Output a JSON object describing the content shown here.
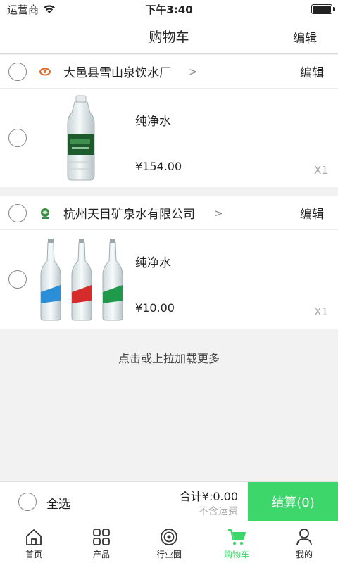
{
  "status_bar": {
    "carrier": "运营商",
    "time": "下午3:40"
  },
  "nav": {
    "title": "购物车",
    "edit_label": "编辑"
  },
  "stores": [
    {
      "name": "大邑县雪山泉饮水厂",
      "edit_label": "编辑",
      "items": [
        {
          "name": "纯净水",
          "price": "¥154.00",
          "quantity": "X1"
        }
      ]
    },
    {
      "name": "杭州天目矿泉水有限公司",
      "edit_label": "编辑",
      "items": [
        {
          "name": "纯净水",
          "price": "¥10.00",
          "quantity": "X1"
        }
      ]
    }
  ],
  "load_more": "点击或上拉加载更多",
  "footer": {
    "select_all": "全选",
    "total": "合计¥:0.00",
    "shipping_note": "不含运费",
    "checkout": "结算(0)"
  },
  "tabs": [
    {
      "label": "首页",
      "icon": "home-icon"
    },
    {
      "label": "产品",
      "icon": "grid-icon"
    },
    {
      "label": "行业圈",
      "icon": "circle-icon"
    },
    {
      "label": "购物车",
      "icon": "cart-icon",
      "active": true
    },
    {
      "label": "我的",
      "icon": "profile-icon"
    }
  ],
  "colors": {
    "accent": "#3dd66a",
    "background": "#f2f2f2"
  }
}
